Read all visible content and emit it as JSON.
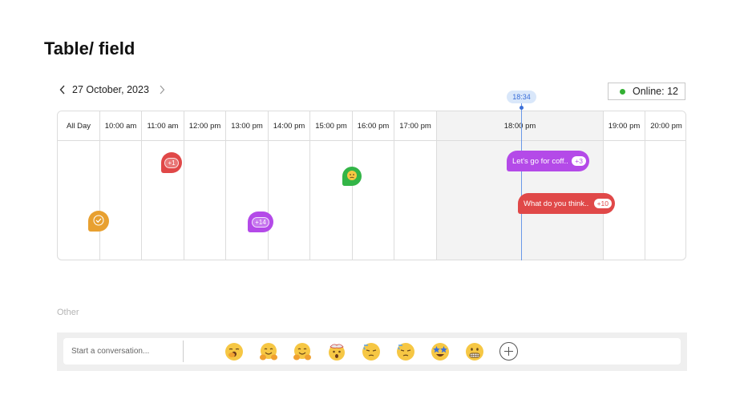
{
  "page": {
    "title": "Table/ field"
  },
  "date_nav": {
    "date": "27 October, 2023",
    "prev_icon": "chevron-left-icon",
    "next_icon": "chevron-right-icon"
  },
  "online": {
    "label": "Online: 12",
    "status_color": "#33b033"
  },
  "current_time": "18:34",
  "columns": [
    "All Day",
    "10:00 am",
    "11:00 am",
    "12:00 pm",
    "13:00 pm",
    "14:00 pm",
    "15:00 pm",
    "16:00 pm",
    "17:00 pm",
    "18:00 pm",
    "19:00 pm",
    "20:00 pm"
  ],
  "events": {
    "allday": {
      "icon": "check-icon",
      "color": "#e8a030"
    },
    "eleven": {
      "count": "+1",
      "color": "#e04848"
    },
    "thirteen": {
      "count": "+14",
      "color": "#b44ae8"
    },
    "sixteen": {
      "icon": "face-emoji-icon",
      "color": "#33b547"
    },
    "pill1": {
      "text": "Let's go for coff..",
      "count": "+3",
      "color": "#b44ae8"
    },
    "pill2": {
      "text": "What do you think..",
      "count": "+10",
      "color": "#e04848"
    }
  },
  "other": {
    "label": "Other"
  },
  "composer": {
    "placeholder": "Start a conversation...",
    "emojis": [
      "yawning-face-emoji",
      "hugging-face-emoji",
      "hugging-face-emoji",
      "exploding-head-emoji",
      "downcast-sweat-face-emoji",
      "downcast-sweat-face-emoji",
      "star-struck-emoji",
      "grimacing-face-emoji"
    ],
    "add_icon": "plus-circle-icon"
  }
}
